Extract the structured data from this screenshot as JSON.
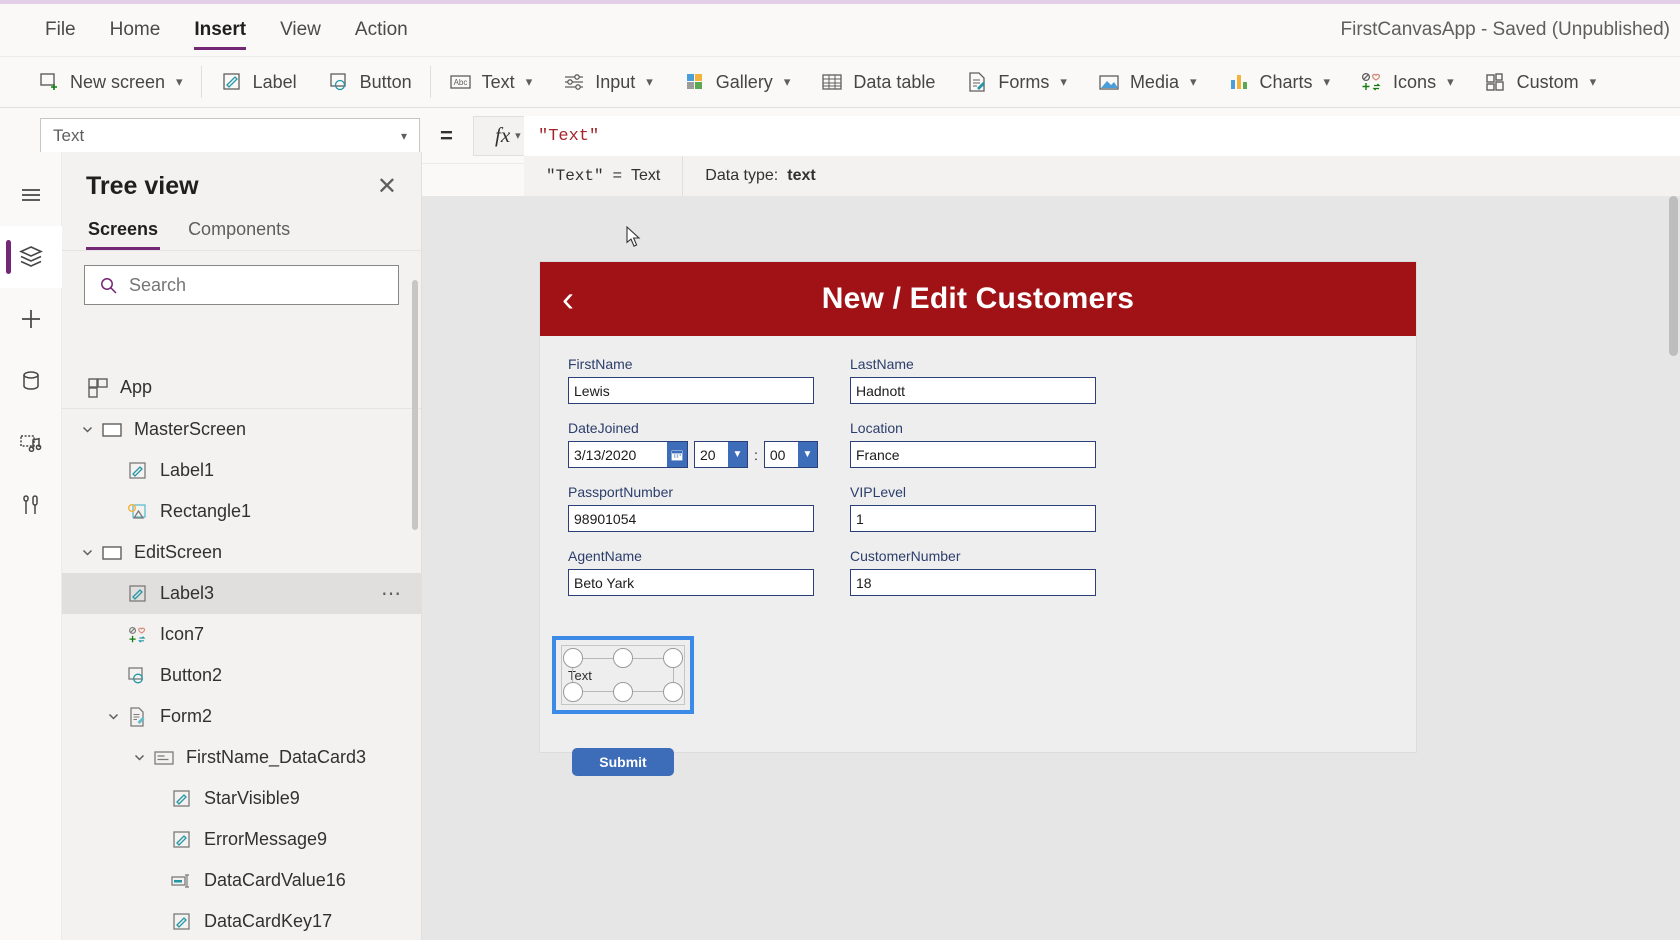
{
  "window": {
    "app_title": "FirstCanvasApp - Saved (Unpublished)"
  },
  "menubar": {
    "items": [
      {
        "label": "File",
        "active": false
      },
      {
        "label": "Home",
        "active": false
      },
      {
        "label": "Insert",
        "active": true
      },
      {
        "label": "View",
        "active": false
      },
      {
        "label": "Action",
        "active": false
      }
    ]
  },
  "ribbon": {
    "items": [
      {
        "label": "New screen",
        "icon": "new-screen-icon",
        "caret": true
      },
      {
        "label": "Label",
        "icon": "label-icon",
        "caret": false
      },
      {
        "label": "Button",
        "icon": "button-icon",
        "caret": false
      },
      {
        "label": "Text",
        "icon": "text-icon",
        "caret": true
      },
      {
        "label": "Input",
        "icon": "input-icon",
        "caret": true
      },
      {
        "label": "Gallery",
        "icon": "gallery-icon",
        "caret": true
      },
      {
        "label": "Data table",
        "icon": "data-table-icon",
        "caret": false
      },
      {
        "label": "Forms",
        "icon": "forms-icon",
        "caret": true
      },
      {
        "label": "Media",
        "icon": "media-icon",
        "caret": true
      },
      {
        "label": "Charts",
        "icon": "charts-icon",
        "caret": true
      },
      {
        "label": "Icons",
        "icon": "icons-icon",
        "caret": true
      },
      {
        "label": "Custom",
        "icon": "custom-icon",
        "caret": true
      }
    ]
  },
  "formula_bar": {
    "property": "Text",
    "equals": "=",
    "fx": "fx",
    "value": "\"Text\"",
    "help_expression": "\"Text\"",
    "help_equals": "=",
    "help_result": "Text",
    "help_datatype_label": "Data type:",
    "help_datatype_value": "text"
  },
  "rail": {
    "items": [
      {
        "name": "hamburger-menu-icon",
        "selected": false
      },
      {
        "name": "tree-view-icon",
        "selected": true
      },
      {
        "name": "insert-icon",
        "selected": false
      },
      {
        "name": "data-icon",
        "selected": false
      },
      {
        "name": "media-icon",
        "selected": false
      },
      {
        "name": "advanced-tools-icon",
        "selected": false
      }
    ]
  },
  "tree_panel": {
    "title": "Tree view",
    "close": "✕",
    "tabs": [
      {
        "label": "Screens",
        "active": true
      },
      {
        "label": "Components",
        "active": false
      }
    ],
    "search_placeholder": "Search",
    "search_value": "",
    "nodes": [
      {
        "label": "App",
        "icon": "app-icon",
        "indent": 0,
        "chevron": "",
        "selected": false,
        "divider_after": true
      },
      {
        "label": "MasterScreen",
        "icon": "screen-icon",
        "indent": 0,
        "chevron": "⌄",
        "selected": false
      },
      {
        "label": "Label1",
        "icon": "label-icon",
        "indent": 1,
        "chevron": "",
        "selected": false
      },
      {
        "label": "Rectangle1",
        "icon": "shape-icon",
        "indent": 1,
        "chevron": "",
        "selected": false
      },
      {
        "label": "EditScreen",
        "icon": "screen-icon",
        "indent": 0,
        "chevron": "⌄",
        "selected": false
      },
      {
        "label": "Label3",
        "icon": "label-icon",
        "indent": 1,
        "chevron": "",
        "selected": true,
        "dots": "⋯"
      },
      {
        "label": "Icon7",
        "icon": "icons-icon",
        "indent": 1,
        "chevron": "",
        "selected": false
      },
      {
        "label": "Button2",
        "icon": "button-icon",
        "indent": 1,
        "chevron": "",
        "selected": false
      },
      {
        "label": "Form2",
        "icon": "forms-icon",
        "indent": 1,
        "chevron": "⌄",
        "selected": false
      },
      {
        "label": "FirstName_DataCard3",
        "icon": "datacard-icon",
        "indent": 2,
        "chevron": "⌄",
        "selected": false
      },
      {
        "label": "StarVisible9",
        "icon": "label-icon",
        "indent": 3,
        "chevron": "",
        "selected": false
      },
      {
        "label": "ErrorMessage9",
        "icon": "label-icon",
        "indent": 3,
        "chevron": "",
        "selected": false
      },
      {
        "label": "DataCardValue16",
        "icon": "textinput-icon",
        "indent": 3,
        "chevron": "",
        "selected": false
      },
      {
        "label": "DataCardKey17",
        "icon": "label-icon",
        "indent": 3,
        "chevron": "",
        "selected": false
      }
    ]
  },
  "canvas": {
    "form": {
      "title": "New / Edit Customers",
      "back_icon": "back-chevron-icon",
      "header_color": "#a01216",
      "fields": [
        {
          "label": "FirstName",
          "value": "Lewis",
          "type": "text"
        },
        {
          "label": "LastName",
          "value": "Hadnott",
          "type": "text"
        },
        {
          "label": "DateJoined",
          "value": "3/13/2020",
          "hour": "20",
          "minute": "00",
          "separator": ":",
          "type": "datetime"
        },
        {
          "label": "Location",
          "value": "France",
          "type": "text"
        },
        {
          "label": "PassportNumber",
          "value": "98901054",
          "type": "text"
        },
        {
          "label": "VIPLevel",
          "value": "1",
          "type": "text"
        },
        {
          "label": "AgentName",
          "value": "Beto Yark",
          "type": "text"
        },
        {
          "label": "CustomerNumber",
          "value": "18",
          "type": "text"
        }
      ],
      "selected_control": {
        "text": "Text",
        "selection_color": "#3b8ae8"
      },
      "submit_label": "Submit",
      "submit_color": "#3d6cb9"
    }
  }
}
